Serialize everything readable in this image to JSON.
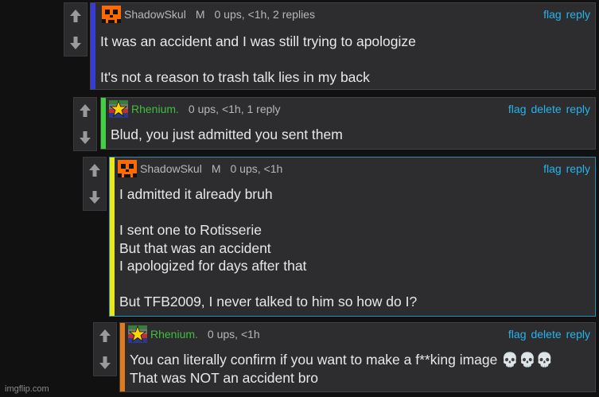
{
  "comments": [
    {
      "username": "ShadowSkul",
      "badge": "M",
      "meta": "0 ups, <1h, 2 replies",
      "actions": [
        "flag",
        "reply"
      ],
      "lines": [
        "It was an accident and I was still trying to apologize",
        "",
        "It's not a reason to trash talk lies in my back"
      ],
      "bar_color": "#3a3ad8"
    },
    {
      "username": "Rhenium.",
      "badge": "",
      "meta": "0 ups, <1h, 1 reply",
      "actions": [
        "flag",
        "delete",
        "reply"
      ],
      "lines": [
        "Blud, you just admitted you sent them"
      ],
      "bar_color": "#3fd33f"
    },
    {
      "username": "ShadowSkul",
      "badge": "M",
      "meta": "0 ups, <1h",
      "actions": [
        "flag",
        "reply"
      ],
      "lines": [
        "I admitted it already bruh",
        "",
        "I sent one to Rotisserie",
        "But that was an accident",
        "I apologized for days after that",
        "",
        "But TFB2009, I never talked to him so how do I?"
      ],
      "bar_color": "#e8e81e"
    },
    {
      "username": "Rhenium.",
      "badge": "",
      "meta": "0 ups, <1h",
      "actions": [
        "flag",
        "delete",
        "reply"
      ],
      "lines": [
        "You can literally confirm if you want to make a f**king image 💀💀💀",
        "That was NOT an accident bro"
      ],
      "bar_color": "#e07a1a"
    }
  ],
  "watermark": "imgflip.com",
  "colors": {
    "link": "#26b4ee",
    "rhenium_name": "#3fbf3f",
    "background": "#111112",
    "comment_bg": "#2d2d2f"
  },
  "icons": {
    "upvote": "upvote-arrow-icon",
    "downvote": "downvote-arrow-icon",
    "shadow_avatar": "orange-skull-avatar-icon",
    "rhenium_avatar": "star-avatar-icon"
  }
}
